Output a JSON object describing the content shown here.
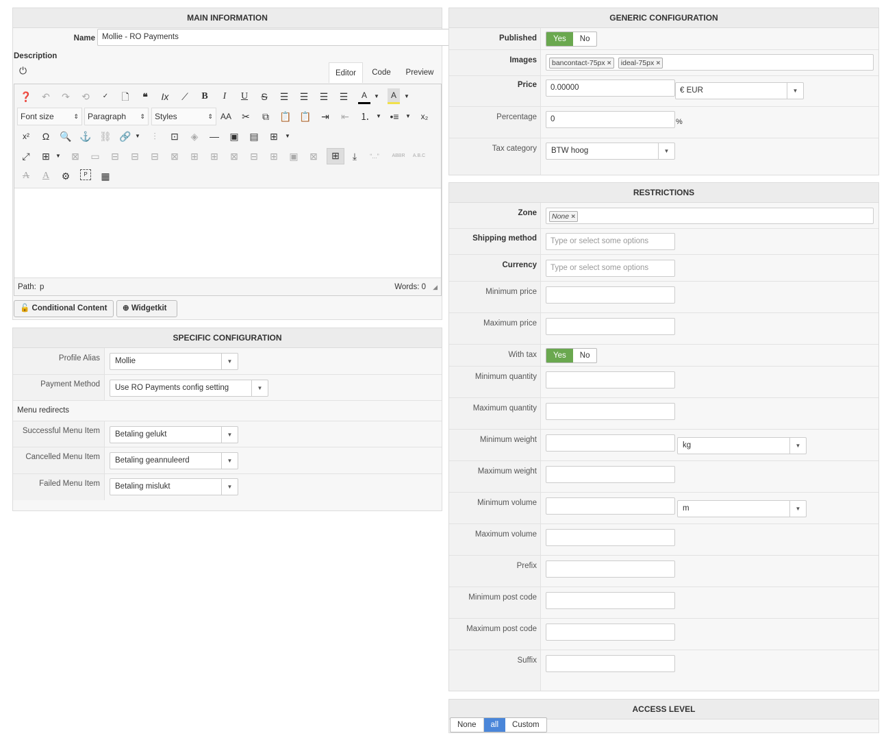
{
  "main_info": {
    "title": "MAIN INFORMATION",
    "name_label": "Name",
    "name_value": "Mollie - RO Payments",
    "description_label": "Description",
    "editor_tabs": [
      "Editor",
      "Code",
      "Preview"
    ],
    "font_size": "Font size",
    "paragraph": "Paragraph",
    "styles": "Styles",
    "path_label": "Path:",
    "path_value": "p",
    "words": "Words: 0",
    "conditional_btn": "Conditional Content",
    "widgetkit_btn": "Widgetkit"
  },
  "specific": {
    "title": "SPECIFIC CONFIGURATION",
    "profile_alias_label": "Profile Alias",
    "profile_alias_value": "Mollie",
    "payment_method_label": "Payment Method",
    "payment_method_value": "Use RO Payments config setting",
    "menu_redirects": "Menu redirects",
    "successful_label": "Successful Menu Item",
    "successful_value": "Betaling gelukt",
    "cancelled_label": "Cancelled Menu Item",
    "cancelled_value": "Betaling geannuleerd",
    "failed_label": "Failed Menu Item",
    "failed_value": "Betaling mislukt"
  },
  "generic": {
    "title": "GENERIC CONFIGURATION",
    "published_label": "Published",
    "yes": "Yes",
    "no": "No",
    "images_label": "Images",
    "image_tags": [
      "bancontact-75px",
      "ideal-75px"
    ],
    "price_label": "Price",
    "price_value": "0.00000",
    "currency_value": "€ EUR",
    "percentage_label": "Percentage",
    "percentage_value": "0",
    "percent_sign": "%",
    "tax_label": "Tax category",
    "tax_value": "BTW hoog"
  },
  "restrictions": {
    "title": "RESTRICTIONS",
    "zone_label": "Zone",
    "zone_tag": "None",
    "shipping_label": "Shipping method",
    "currency_label": "Currency",
    "placeholder": "Type or select some options",
    "min_price": "Minimum price",
    "max_price": "Maximum price",
    "with_tax": "With tax",
    "min_qty": "Minimum quantity",
    "max_qty": "Maximum quantity",
    "min_weight": "Minimum weight",
    "weight_unit": "kg",
    "max_weight": "Maximum weight",
    "min_volume": "Minimum volume",
    "volume_unit": "m",
    "max_volume": "Maximum volume",
    "prefix": "Prefix",
    "min_post": "Minimum post code",
    "max_post": "Maximum post code",
    "suffix": "Suffix"
  },
  "access": {
    "title": "ACCESS LEVEL",
    "options": [
      "None",
      "all",
      "Custom"
    ],
    "selected": "all"
  },
  "colors": {
    "yes_green": "#6aa84f",
    "access_blue": "#4a86d9"
  }
}
